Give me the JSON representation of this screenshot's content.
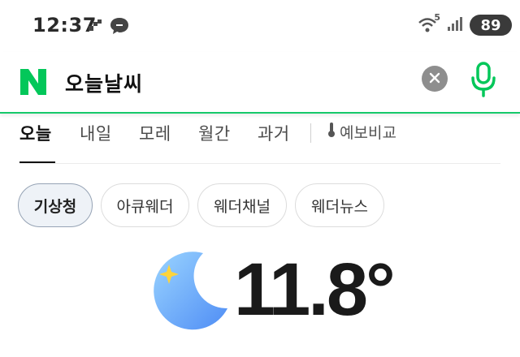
{
  "status_bar": {
    "time": "12:37",
    "battery": "89",
    "wifi_label": "5",
    "icons": [
      "threads-icon",
      "talk-bubble-icon",
      "wifi-icon",
      "signal-icon"
    ]
  },
  "search": {
    "query": "오늘날씨",
    "brand_color": "#03c75a",
    "icons": [
      "naver-logo-icon",
      "clear-icon",
      "microphone-icon"
    ]
  },
  "tabs": {
    "items": [
      {
        "label": "오늘",
        "active": true
      },
      {
        "label": "내일",
        "active": false
      },
      {
        "label": "모레",
        "active": false
      },
      {
        "label": "월간",
        "active": false
      },
      {
        "label": "과거",
        "active": false
      }
    ],
    "compare_label": "예보비교"
  },
  "sources": {
    "items": [
      {
        "label": "기상청",
        "selected": true
      },
      {
        "label": "아큐웨더",
        "selected": false
      },
      {
        "label": "웨더채널",
        "selected": false
      },
      {
        "label": "웨더뉴스",
        "selected": false
      }
    ]
  },
  "weather": {
    "temperature": "11.8°",
    "condition_icon": "moon-night-icon",
    "star_icon": "sparkle-icon"
  }
}
